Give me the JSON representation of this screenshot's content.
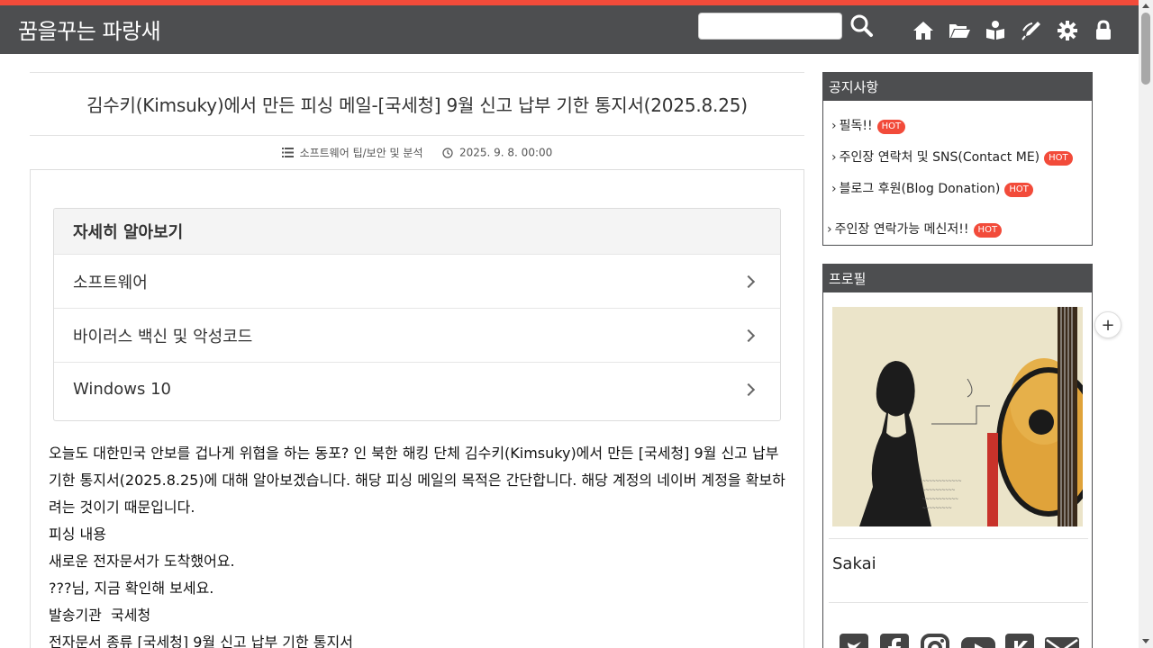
{
  "header": {
    "site_title": "꿈을꾸는 파랑새",
    "search_placeholder": "",
    "icons": [
      "search-icon",
      "home-icon",
      "folder-icon",
      "guestbook-icon",
      "write-icon",
      "settings-icon",
      "lock-icon"
    ]
  },
  "colors": {
    "accent": "#f24b3a",
    "header_bg": "#4d4e50",
    "hot_badge": "#f24b3a"
  },
  "article": {
    "title": "김수키(Kimsuky)에서 만든 피싱 메일-[국세청] 9월 신고 납부 기한 통지서(2025.8.25)",
    "category": "소프트웨어 팁/보안 및 분석",
    "date": "2025. 9. 8. 00:00",
    "learn_more": {
      "heading": "자세히 알아보기",
      "items": [
        "소프트웨어",
        "바이러스 백신 및 악성코드",
        "Windows 10"
      ]
    },
    "paragraphs": [
      "오늘도 대한민국 안보를 겁나게 위협을 하는 동포? 인 북한 해킹 단체 김수키(Kimsuky)에서 만든 [국세청] 9월 신고 납부 기한 통지서(2025.8.25)에 대해 알아보겠습니다. 해당 피싱 메일의 목적은 간단합니다. 해당 계정의 네이버 계정을 확보하려는 것이기 때문입니다.",
      "피싱 내용",
      "새로운 전자문서가 도착했어요.",
      "???님, 지금 확인해 보세요.",
      "발송기관  국세청",
      "전자문서 종류 [국세청] 9월 신고 납부 기한 통지서"
    ]
  },
  "sidebar": {
    "notice": {
      "heading": "공지사항",
      "items": [
        {
          "label": "필독!!",
          "badge": "HOT"
        },
        {
          "label": "주인장 연락처 및 SNS(Contact ME)",
          "badge": "HOT"
        },
        {
          "label": "블로그 후원(Blog Donation)",
          "badge": "HOT"
        },
        {
          "label": "주인장 연락가능 메신저!!",
          "badge": "HOT"
        }
      ]
    },
    "profile": {
      "heading": "프로필",
      "name": "Sakai",
      "social_icons": [
        "twitter-icon",
        "facebook-icon",
        "instagram-icon",
        "youtube-icon",
        "kakao-icon",
        "email-icon"
      ]
    }
  },
  "floating": {
    "plus_label": "+"
  }
}
